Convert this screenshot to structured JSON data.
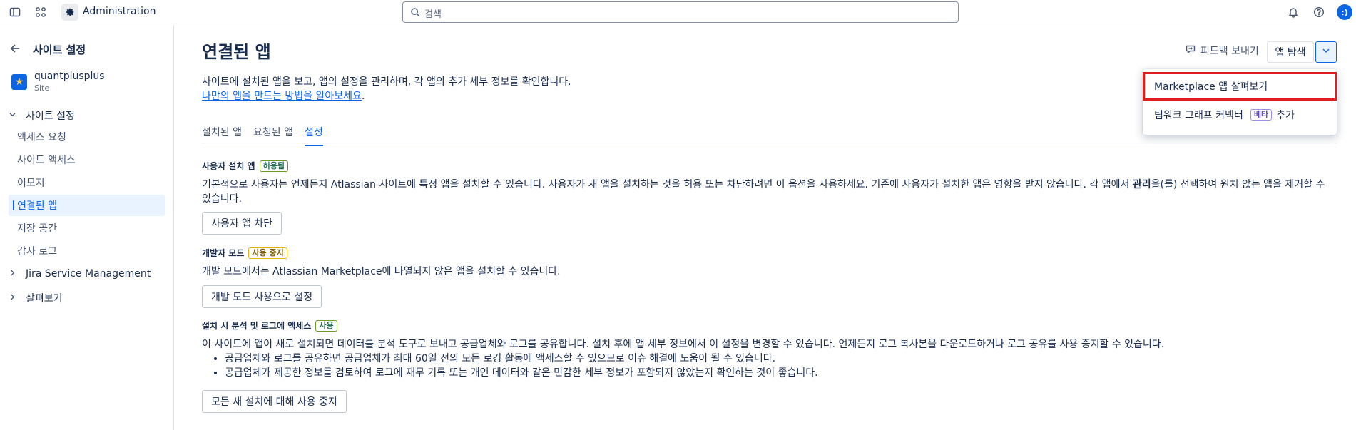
{
  "topbar": {
    "app_title": "Administration",
    "search_placeholder": "검색",
    "avatar_text": ":)"
  },
  "sidebar": {
    "back_title": "사이트 설정",
    "site_name": "quantplusplus",
    "site_type": "Site",
    "group_site_settings": "사이트 설정",
    "items": [
      {
        "label": "액세스 요청"
      },
      {
        "label": "사이트 액세스"
      },
      {
        "label": "이모지"
      },
      {
        "label": "연결된 앱",
        "active": true
      },
      {
        "label": "저장 공간"
      },
      {
        "label": "감사 로그"
      }
    ],
    "group_jsm": "Jira Service Management",
    "group_explore": "살펴보기"
  },
  "main": {
    "title": "연결된 앱",
    "feedback_label": "피드백 보내기",
    "explore_button": "앱 탐색",
    "description_line1": "사이트에 설치된 앱을 보고, 앱의 설정을 관리하며, 각 앱의 추가 세부 정보를 확인합니다.",
    "description_link": "나만의 앱을 만드는 방법을 알아보세요",
    "description_link_suffix": ".",
    "tabs": [
      {
        "label": "설치된 앱"
      },
      {
        "label": "요청된 앱"
      },
      {
        "label": "설정",
        "active": true
      }
    ],
    "user_install": {
      "heading": "사용자 설치 앱",
      "badge": "허용됨",
      "text_before_bold": "기본적으로 사용자는 언제든지 Atlassian 사이트에 특정 앱을 설치할 수 있습니다. 사용자가 새 앱을 설치하는 것을 허용 또는 차단하려면 이 옵션을 사용하세요. 기존에 사용자가 설치한 앱은 영향을 받지 않습니다. 각 앱에서 ",
      "text_bold": "관리",
      "text_after_bold": "을(를) 선택하여 원치 않는 앱을 제거할 수 있습니다.",
      "button": "사용자 앱 차단"
    },
    "dev_mode": {
      "heading": "개발자 모드",
      "badge": "사용 중지",
      "text": "개발 모드에서는 Atlassian Marketplace에 나열되지 않은 앱을 설치할 수 있습니다.",
      "button": "개발 모드 사용으로 설정"
    },
    "analytics": {
      "heading": "설치 시 분석 및 로그에 액세스",
      "badge": "사용",
      "text": "이 사이트에 앱이 새로 설치되면 데이터를 분석 도구로 보내고 공급업체와 로그를 공유합니다. 설치 후에 앱 세부 정보에서 이 설정을 변경할 수 있습니다. 언제든지 로그 복사본을 다운로드하거나 로그 공유를 사용 중지할 수 있습니다.",
      "bullets": [
        "공급업체와 로그를 공유하면 공급업체가 최대 60일 전의 모든 로깅 활동에 액세스할 수 있으므로 이슈 해결에 도움이 될 수 있습니다.",
        "공급업체가 제공한 정보를 검토하여 로그에 재무 기록 또는 개인 데이터와 같은 민감한 세부 정보가 포함되지 않았는지 확인하는 것이 좋습니다."
      ],
      "button": "모든 새 설치에 대해 사용 중지"
    }
  },
  "dropdown": {
    "item1": "Marketplace 앱 살펴보기",
    "item2_prefix": "팀워크 그래프 커넥터",
    "item2_badge": "베타",
    "item2_suffix": "추가"
  },
  "colors": {
    "accent": "#0c66e4",
    "highlight_outline": "#e01e1e"
  }
}
